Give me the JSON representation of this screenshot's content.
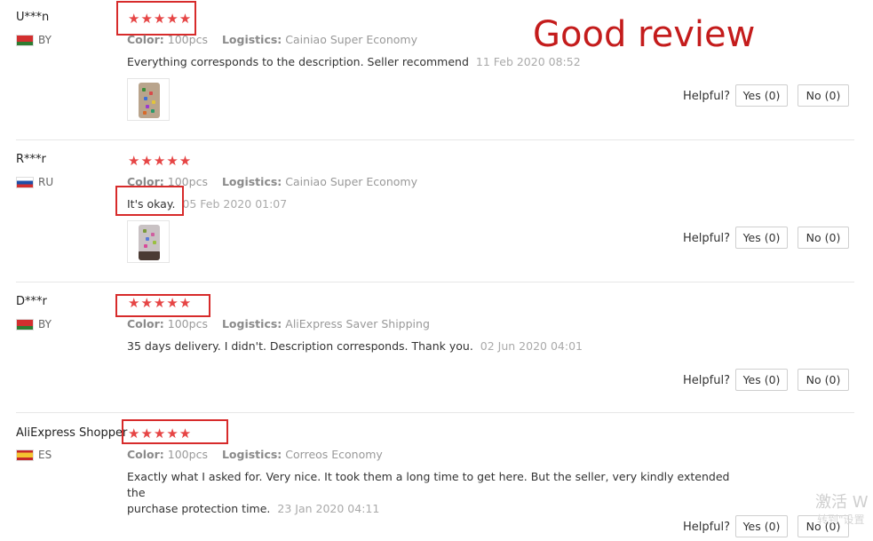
{
  "annotation": {
    "good_review": "Good review"
  },
  "labels": {
    "color": "Color:",
    "logistics": "Logistics:",
    "helpful": "Helpful?"
  },
  "reviews": [
    {
      "user": "U***n",
      "country": "BY",
      "stars": "★★★★★",
      "color": "100pcs",
      "logistics": "Cainiao Super Economy",
      "text": "Everything corresponds to the description. Seller recommend",
      "date": "11 Feb 2020 08:52",
      "has_photo": true,
      "yes": "Yes (0)",
      "no": "No (0)"
    },
    {
      "user": "R***r",
      "country": "RU",
      "stars": "★★★★★",
      "color": "100pcs",
      "logistics": "Cainiao Super Economy",
      "text": "It's okay.",
      "date": "05 Feb 2020 01:07",
      "has_photo": true,
      "yes": "Yes (0)",
      "no": "No (0)"
    },
    {
      "user": "D***r",
      "country": "BY",
      "stars": "★★★★★",
      "color": "100pcs",
      "logistics": "AliExpress Saver Shipping",
      "text": "35 days delivery. I didn't. Description corresponds. Thank you.",
      "date": "02 Jun 2020 04:01",
      "has_photo": false,
      "yes": "Yes (0)",
      "no": "No (0)"
    },
    {
      "user": "AliExpress Shopper",
      "country": "ES",
      "stars": "★★★★★",
      "color": "100pcs",
      "logistics": "Correos Economy",
      "text_line1": "Exactly what I asked for. Very nice. It took them a long time to get here. But the seller, very kindly extended the",
      "text_line2": "purchase protection time.",
      "date": "23 Jan 2020 04:11",
      "has_photo": false,
      "yes": "Yes (0)",
      "no": "No (0)"
    }
  ],
  "watermark": {
    "line1": "激活 W",
    "line2": "转到\"设置"
  }
}
